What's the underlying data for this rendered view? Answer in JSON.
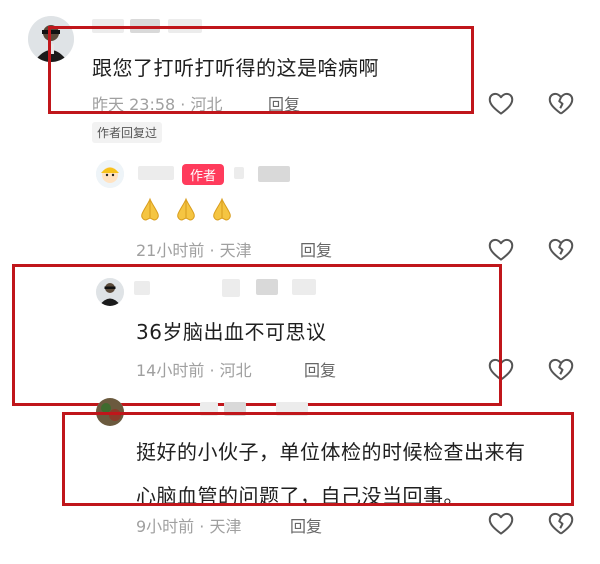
{
  "comments": [
    {
      "text": "跟您了打听打听得的这是啥病啊",
      "time": "昨天 23:58",
      "location": "河北",
      "reply_label": "回复",
      "badge": "作者回复过"
    },
    {
      "author_tag": "作者",
      "emoji": "🙏🙏🙏",
      "time": "21小时前",
      "location": "天津",
      "reply_label": "回复"
    },
    {
      "text": "36岁脑出血不可思议",
      "time": "14小时前",
      "location": "河北",
      "reply_label": "回复"
    },
    {
      "text_line1": "挺好的小伙子，单位体检的时候检查出来有",
      "text_line2": "心脑血管的问题了，自己没当回事。",
      "time": "9小时前",
      "location": "天津",
      "reply_label": "回复"
    }
  ],
  "meta_separator": " · ",
  "colors": {
    "highlight_border": "#c0161b",
    "author_tag": "#ff3b5c",
    "meta_text": "#a0a0a0"
  },
  "icons": [
    "heart-icon",
    "broken-heart-icon",
    "praying-hands-icon"
  ]
}
